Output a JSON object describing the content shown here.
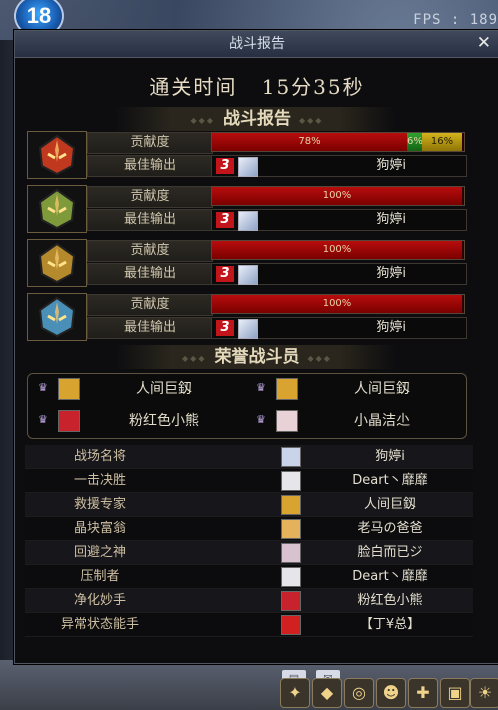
{
  "hud": {
    "level": "18",
    "fps_label": "FPS : 189"
  },
  "window": {
    "title": "战斗报告",
    "close_symbol": "✕"
  },
  "clear_time": {
    "label": "通关时间",
    "value": "15分35秒"
  },
  "report_header": "战斗报告",
  "report_rows": [
    {
      "avatar_color": "#c0391f",
      "contribution_label": "贡献度",
      "best_label": "最佳输出",
      "segments": [
        {
          "pct": 78,
          "text": "78%",
          "color": "red"
        },
        {
          "pct": 6,
          "text": "6%",
          "color": "green"
        },
        {
          "pct": 16,
          "text": "16%",
          "color": "yellow"
        }
      ],
      "rank": "3",
      "player": "狗婷i"
    },
    {
      "avatar_color": "#7f9a3a",
      "contribution_label": "贡献度",
      "best_label": "最佳输出",
      "segments": [
        {
          "pct": 100,
          "text": "100%",
          "color": "red"
        }
      ],
      "rank": "3",
      "player": "狗婷i"
    },
    {
      "avatar_color": "#b58a2c",
      "contribution_label": "贡献度",
      "best_label": "最佳输出",
      "segments": [
        {
          "pct": 100,
          "text": "100%",
          "color": "red"
        }
      ],
      "rank": "3",
      "player": "狗婷i"
    },
    {
      "avatar_color": "#4a8fb8",
      "contribution_label": "贡献度",
      "best_label": "最佳输出",
      "segments": [
        {
          "pct": 100,
          "text": "100%",
          "color": "red"
        }
      ],
      "rank": "3",
      "player": "狗婷i"
    }
  ],
  "honor_header": "荣誉战斗员",
  "honor_players": [
    {
      "name": "人间巨釼",
      "avatar_color": "#d9a330"
    },
    {
      "name": "人间巨釼",
      "avatar_color": "#d9a330"
    },
    {
      "name": "粉红色小熊",
      "avatar_color": "#c8232d"
    },
    {
      "name": "小晶洁尐",
      "avatar_color": "#e8d2d8"
    }
  ],
  "titles": [
    {
      "title": "战场名将",
      "player": "狗婷i",
      "avatar_color": "#c9d4ea"
    },
    {
      "title": "一击决胜",
      "player": "Deart丶靡靡",
      "avatar_color": "#e6e6ea"
    },
    {
      "title": "救援专家",
      "player": "人间巨釼",
      "avatar_color": "#d9a330"
    },
    {
      "title": "晶块富翁",
      "player": "老马の爸爸",
      "avatar_color": "#e3b25a"
    },
    {
      "title": "回避之神",
      "player": "脸白而已ジ",
      "avatar_color": "#d8c2d0"
    },
    {
      "title": "压制者",
      "player": "Deart丶靡靡",
      "avatar_color": "#e6e6ea"
    },
    {
      "title": "净化妙手",
      "player": "粉红色小熊",
      "avatar_color": "#c8232d"
    },
    {
      "title": "异常状态能手",
      "player": "【丁¥总】",
      "avatar_color": "#d02020"
    }
  ]
}
